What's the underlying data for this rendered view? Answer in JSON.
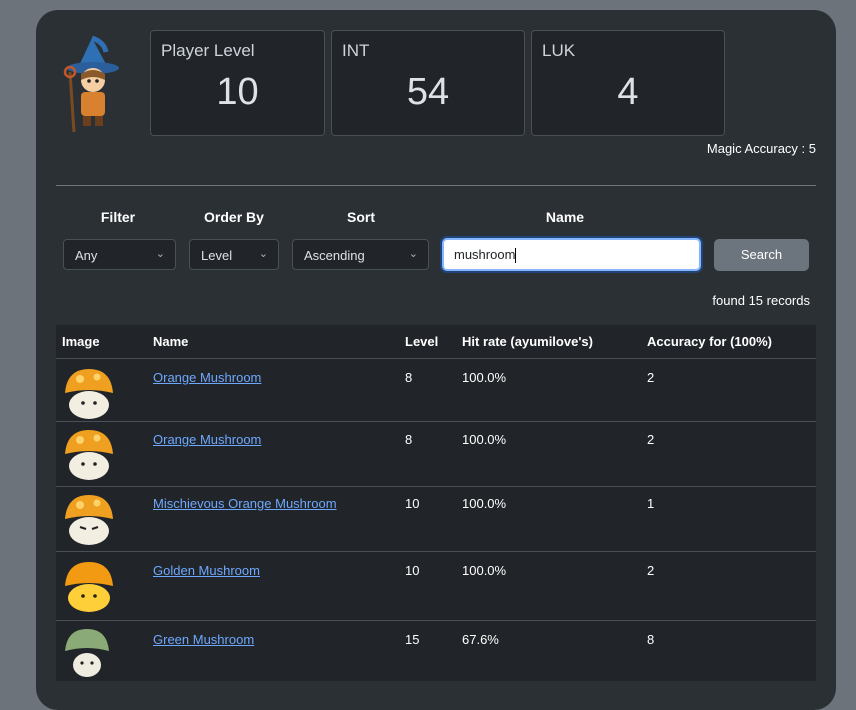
{
  "stats": {
    "player_level": {
      "label": "Player Level",
      "value": "10"
    },
    "int": {
      "label": "INT",
      "value": "54"
    },
    "luk": {
      "label": "LUK",
      "value": "4"
    }
  },
  "magic_accuracy": "Magic Accuracy : 5",
  "filters": {
    "filter": {
      "label": "Filter",
      "value": "Any"
    },
    "order_by": {
      "label": "Order By",
      "value": "Level"
    },
    "sort": {
      "label": "Sort",
      "value": "Ascending"
    },
    "name": {
      "label": "Name",
      "value": "mushroom"
    }
  },
  "search_button": "Search",
  "found_text": "found 15 records",
  "table": {
    "headers": [
      "Image",
      "Name",
      "Level",
      "Hit rate (ayumilove's)",
      "Accuracy for (100%)"
    ],
    "rows": [
      {
        "name": "Orange Mushroom",
        "level": "8",
        "hit_rate": "100.0%",
        "accuracy": "2"
      },
      {
        "name": "Orange Mushroom",
        "level": "8",
        "hit_rate": "100.0%",
        "accuracy": "2"
      },
      {
        "name": "Mischievous Orange Mushroom",
        "level": "10",
        "hit_rate": "100.0%",
        "accuracy": "1"
      },
      {
        "name": "Golden Mushroom",
        "level": "10",
        "hit_rate": "100.0%",
        "accuracy": "2"
      },
      {
        "name": "Green Mushroom",
        "level": "15",
        "hit_rate": "67.6%",
        "accuracy": "8"
      }
    ]
  }
}
